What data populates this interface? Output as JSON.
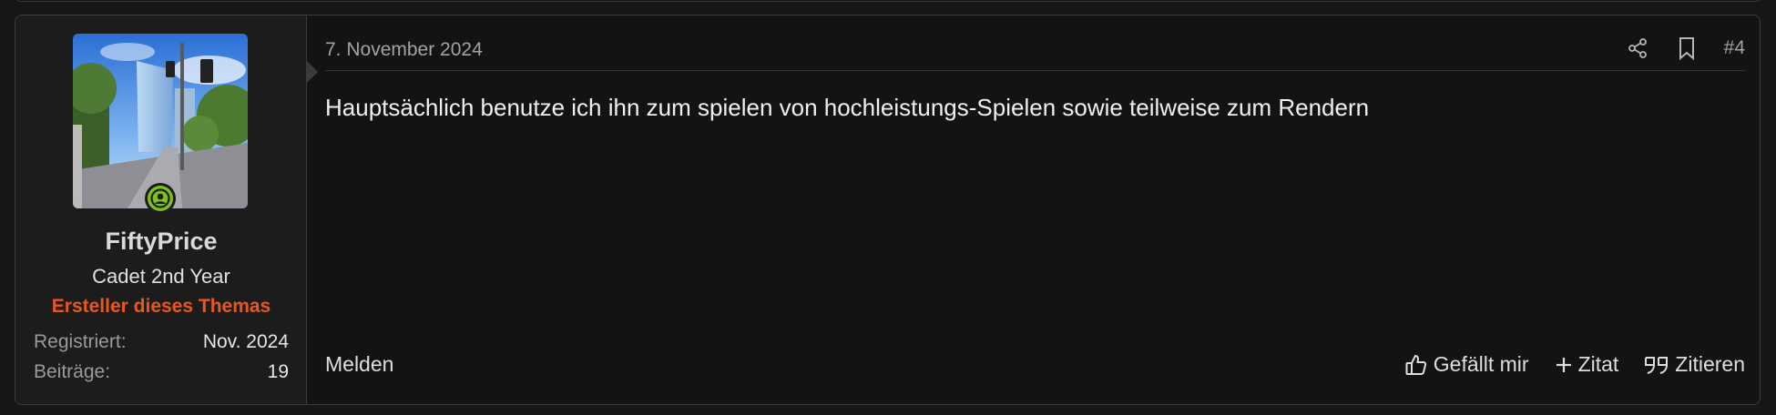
{
  "user": {
    "name": "FiftyPrice",
    "title": "Cadet 2nd Year",
    "badge": "Ersteller dieses Themas",
    "stats": [
      {
        "label": "Registriert:",
        "value": "Nov. 2024"
      },
      {
        "label": "Beiträge:",
        "value": "19"
      }
    ],
    "avatar_icon": "avatar-photo-city-street",
    "online_icon": "user-circle-icon",
    "online_color": "#7cc21a"
  },
  "post": {
    "date": "7. November 2024",
    "number": "#4",
    "content": "Hauptsächlich benutze ich ihn zum spielen von hochleistungs-Spielen sowie teilweise zum Rendern",
    "header_icons": [
      "share-icon",
      "bookmark-icon"
    ]
  },
  "footer": {
    "report_label": "Melden",
    "like_label": "Gefällt mir",
    "add_quote_label": "Zitat",
    "quote_label": "Zitieren"
  },
  "colors": {
    "accent_orange": "#e8581c",
    "background": "#131313",
    "sidebar": "#1c1c1c"
  }
}
